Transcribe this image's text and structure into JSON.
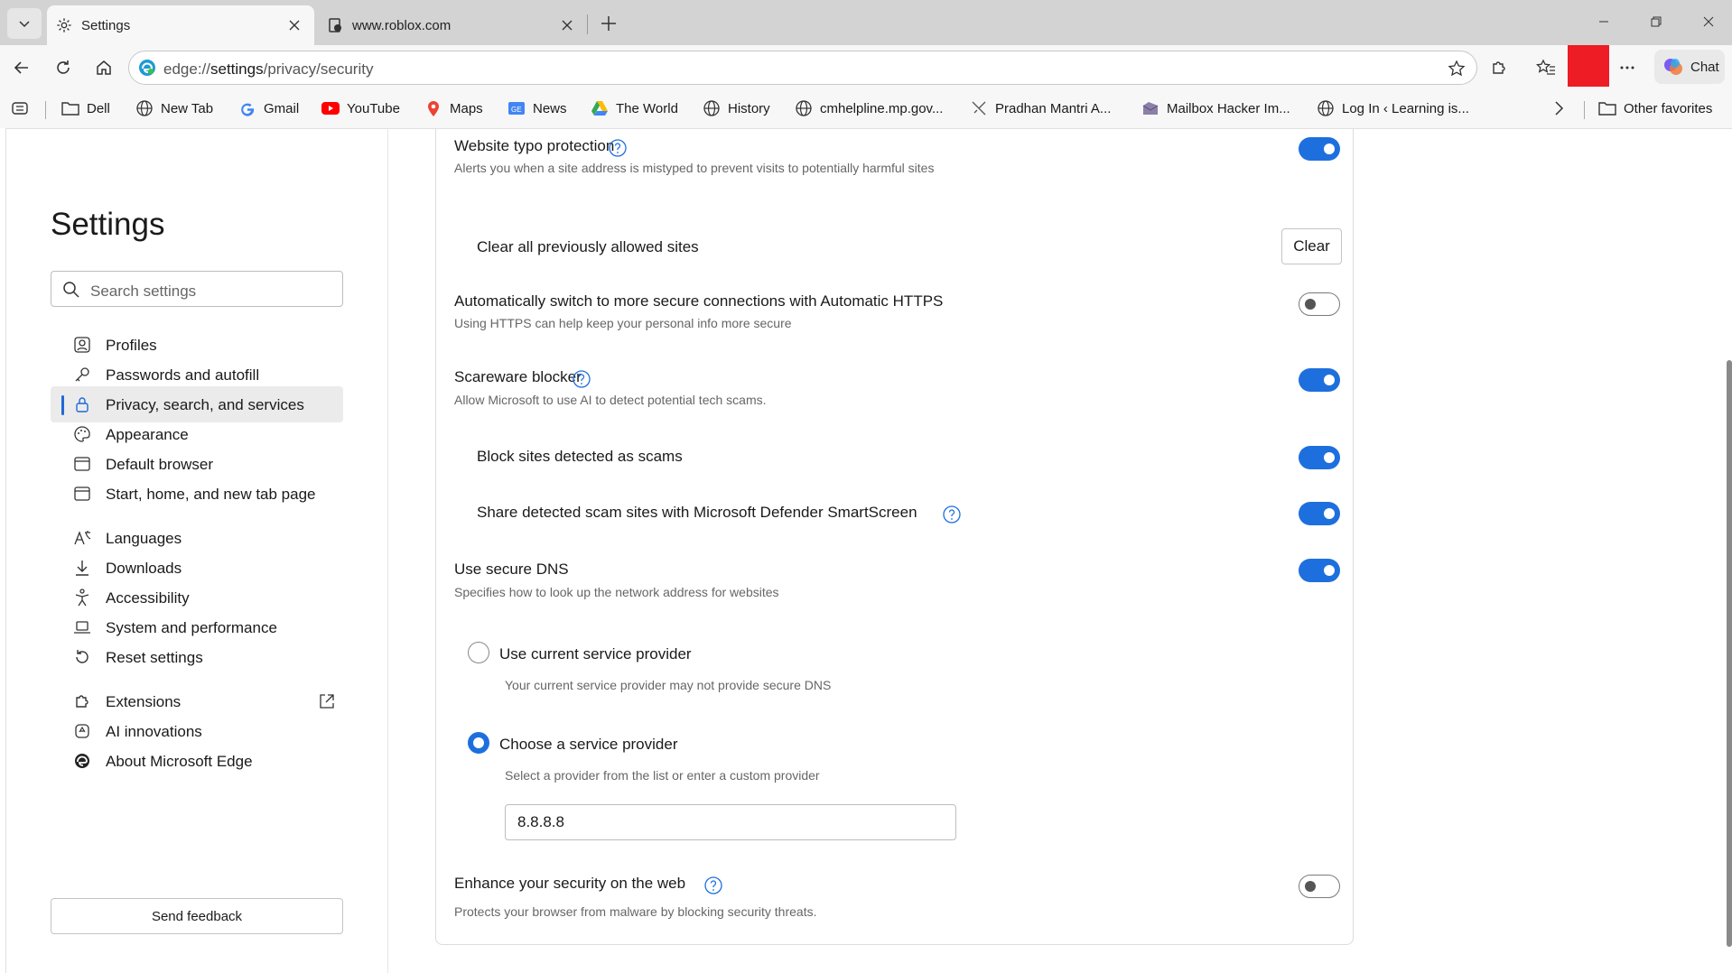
{
  "tabs": [
    {
      "label": "Settings",
      "icon": "gear-icon",
      "active": true
    },
    {
      "label": "www.roblox.com",
      "icon": "roblox-icon",
      "active": false
    }
  ],
  "address_bar": {
    "prefix": "edge://",
    "path": "settings",
    "suffix": "/privacy/security"
  },
  "toolbar": {
    "chat_label": "Chat"
  },
  "favorites": [
    {
      "label": "Dell",
      "icon": "folder-icon"
    },
    {
      "label": "New Tab",
      "icon": "globe-icon"
    },
    {
      "label": "Gmail",
      "icon": "google-icon"
    },
    {
      "label": "YouTube",
      "icon": "youtube-icon"
    },
    {
      "label": "Maps",
      "icon": "map-pin-icon"
    },
    {
      "label": "News",
      "icon": "news-icon"
    },
    {
      "label": "The World",
      "icon": "drive-icon"
    },
    {
      "label": "History",
      "icon": "globe-icon"
    },
    {
      "label": "cmhelpline.mp.gov...",
      "icon": "globe-icon"
    },
    {
      "label": "Pradhan Mantri A...",
      "icon": "site-icon"
    },
    {
      "label": "Mailbox Hacker Im...",
      "icon": "site-icon"
    },
    {
      "label": "Log In ‹ Learning is...",
      "icon": "globe-icon"
    }
  ],
  "other_favorites": "Other favorites",
  "sidebar": {
    "title": "Settings",
    "search_placeholder": "Search settings",
    "items": [
      {
        "label": "Profiles",
        "icon": "profile-icon"
      },
      {
        "label": "Passwords and autofill",
        "icon": "key-icon"
      },
      {
        "label": "Privacy, search, and services",
        "icon": "lock-icon",
        "selected": true
      },
      {
        "label": "Appearance",
        "icon": "palette-icon"
      },
      {
        "label": "Default browser",
        "icon": "browser-icon"
      },
      {
        "label": "Start, home, and new tab page",
        "icon": "home-page-icon"
      },
      {
        "label": "Languages",
        "icon": "languages-icon"
      },
      {
        "label": "Downloads",
        "icon": "download-icon"
      },
      {
        "label": "Accessibility",
        "icon": "accessibility-icon"
      },
      {
        "label": "System and performance",
        "icon": "laptop-icon"
      },
      {
        "label": "Reset settings",
        "icon": "reset-icon"
      },
      {
        "label": "Extensions",
        "icon": "puzzle-icon"
      },
      {
        "label": "AI innovations",
        "icon": "ai-icon"
      },
      {
        "label": "About Microsoft Edge",
        "icon": "edge-logo-icon"
      }
    ],
    "feedback_label": "Send feedback"
  },
  "settings": {
    "typo": {
      "title": "Website typo protection",
      "desc": "Alerts you when a site address is mistyped to prevent visits to potentially harmful sites",
      "enabled": true
    },
    "clear_sites": {
      "title": "Clear all previously allowed sites",
      "button": "Clear"
    },
    "https": {
      "title": "Automatically switch to more secure connections with Automatic HTTPS",
      "desc": "Using HTTPS can help keep your personal info more secure",
      "enabled": false
    },
    "scareware": {
      "title": "Scareware blocker",
      "desc": "Allow Microsoft to use AI to detect potential tech scams.",
      "enabled": true
    },
    "block_scams": {
      "title": "Block sites detected as scams",
      "enabled": true
    },
    "share_scams": {
      "title": "Share detected scam sites with Microsoft Defender SmartScreen",
      "enabled": true
    },
    "secure_dns": {
      "title": "Use secure DNS",
      "desc": "Specifies how to look up the network address for websites",
      "enabled": true,
      "option_current": {
        "title": "Use current service provider",
        "desc": "Your current service provider may not provide secure DNS",
        "checked": false
      },
      "option_choose": {
        "title": "Choose a service provider",
        "desc": "Select a provider from the list or enter a custom provider",
        "checked": true
      },
      "provider_value": "8.8.8.8"
    },
    "enhance": {
      "title": "Enhance your security on the web",
      "desc": "Protects your browser from malware by blocking security threats.",
      "enabled": false
    }
  },
  "colors": {
    "accent": "#1e6fde",
    "red_block": "#ee1c24"
  }
}
